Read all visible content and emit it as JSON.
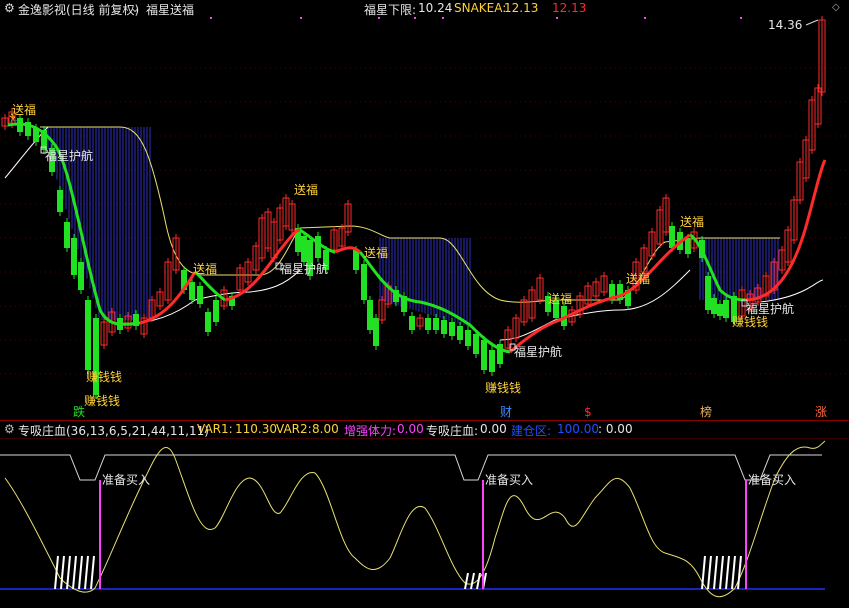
{
  "header": {
    "app_title": "金逸影视(日线 前复权)",
    "indicator_name": "福星送福",
    "lower_limit_label": "福星下限:",
    "lower_limit_value": "10.24",
    "snakea_label": "SNAKEA:",
    "snakea_value": "12.13",
    "snakea_value2": "12.13"
  },
  "main_chart": {
    "price_marker": "14.36",
    "annotations": {
      "songfu": "送福",
      "fuxing": "福星护航",
      "zhuanqian": "赚钱钱"
    },
    "markers": [
      "跌",
      "财",
      "$",
      "榜",
      "涨"
    ]
  },
  "sub_header": {
    "indicator": "专吸庄血(36,13,6,5,21,44,11,11)",
    "var1_label": "VAR1:",
    "var1_value": "110.30",
    "var2_label": "VAR2:",
    "var2_value": "8.00",
    "zengqiang_label": "增强体力:",
    "zengqiang_value": "0.00",
    "zhuanxi_label": "专吸庄血:",
    "zhuanxi_value": "0.00",
    "jiancang_label": "建仓区:",
    "jiancang_value": "100.00",
    "extra_value": ": 0.00"
  },
  "sub_chart": {
    "signal_label": "准备买入"
  },
  "colors": {
    "up": "#ff2a2a",
    "down": "#22e022",
    "fill": "#3030c0",
    "envelope": "#e8e070",
    "divider": "#8a0000",
    "magenta": "#ff40ff"
  }
}
